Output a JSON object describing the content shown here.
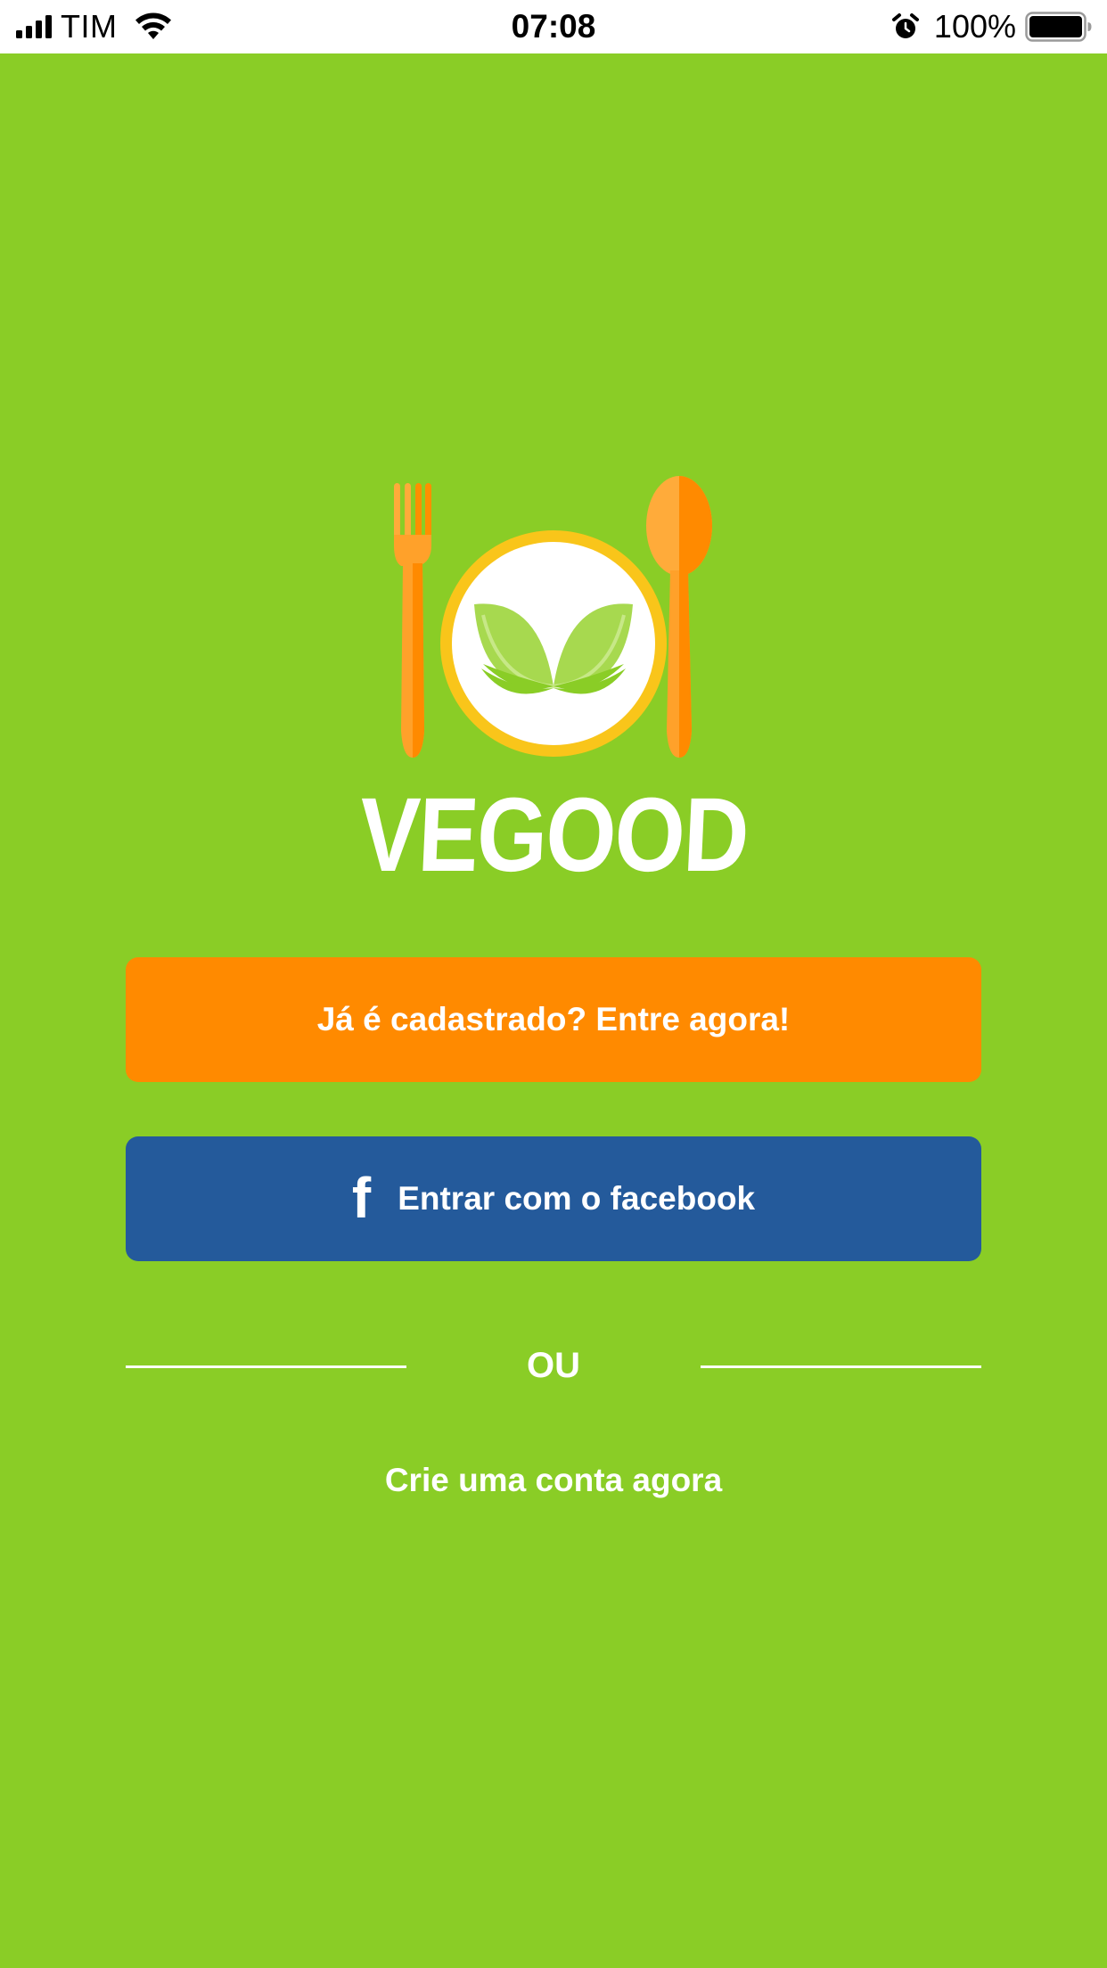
{
  "status_bar": {
    "carrier": "TIM",
    "time": "07:08",
    "battery": "100%"
  },
  "logo": {
    "text": "VEGOOD",
    "icon": "plate-leaf-fork-spoon-logo"
  },
  "login_button": {
    "label": "Já é cadastrado? Entre agora!"
  },
  "facebook_button": {
    "icon": "facebook-icon",
    "icon_glyph": "f",
    "label": "Entrar com o facebook"
  },
  "divider": {
    "label": "OU"
  },
  "create_account": {
    "label": "Crie uma conta agora"
  },
  "colors": {
    "background": "#8acd26",
    "login_button": "#ff8a00",
    "facebook_button": "#245a9b",
    "plate_rim": "#f9c51a",
    "cutlery": "#ff9c1f",
    "leaf": "#8acd26"
  }
}
